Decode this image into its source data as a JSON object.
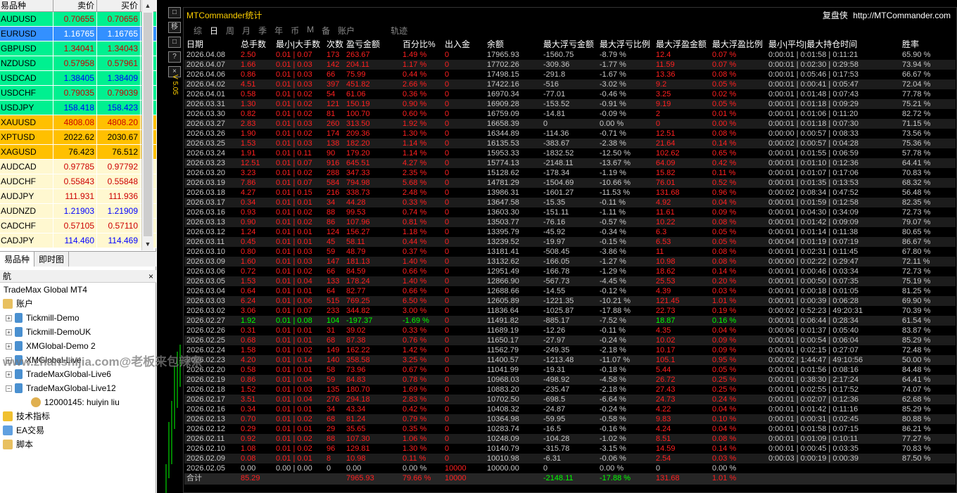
{
  "market_watch": {
    "col_symbol": "易品种",
    "col_bid": "卖价",
    "col_ask": "买价",
    "rows": [
      {
        "s": "AUDUSD",
        "b": "0.70655",
        "a": "0.70656",
        "bg": "#00f090",
        "fg": "#cc0000"
      },
      {
        "s": "EURUSD",
        "b": "1.16765",
        "a": "1.16765",
        "bg": "#3390ff",
        "fg": "#ffffff"
      },
      {
        "s": "GBPUSD",
        "b": "1.34041",
        "a": "1.34043",
        "bg": "#00f090",
        "fg": "#cc0000"
      },
      {
        "s": "NZDUSD",
        "b": "0.57958",
        "a": "0.57961",
        "bg": "#00f090",
        "fg": "#cc0000"
      },
      {
        "s": "USDCAD",
        "b": "1.38405",
        "a": "1.38409",
        "bg": "#00f090",
        "fg": "#0000ff"
      },
      {
        "s": "USDCHF",
        "b": "0.79035",
        "a": "0.79039",
        "bg": "#00f090",
        "fg": "#cc0000"
      },
      {
        "s": "USDJPY",
        "b": "158.418",
        "a": "158.423",
        "bg": "#00f090",
        "fg": "#0000ff"
      },
      {
        "s": "XAUUSD",
        "b": "4808.08",
        "a": "4808.20",
        "bg": "#ffc000",
        "fg": "#cc0000"
      },
      {
        "s": "XPTUSD",
        "b": "2022.62",
        "a": "2030.67",
        "bg": "#ffc000",
        "fg": "#000000"
      },
      {
        "s": "XAGUSD",
        "b": "76.423",
        "a": "76.512",
        "bg": "#ffc000",
        "fg": "#000000"
      },
      {
        "s": "AUDCAD",
        "b": "0.97785",
        "a": "0.97792",
        "bg": "#fff8d0",
        "fg": "#cc0000"
      },
      {
        "s": "AUDCHF",
        "b": "0.55843",
        "a": "0.55848",
        "bg": "#fff8d0",
        "fg": "#cc0000"
      },
      {
        "s": "AUDJPY",
        "b": "111.931",
        "a": "111.936",
        "bg": "#fff8d0",
        "fg": "#cc0000"
      },
      {
        "s": "AUDNZD",
        "b": "1.21903",
        "a": "1.21909",
        "bg": "#fff8d0",
        "fg": "#0000ff"
      },
      {
        "s": "CADCHF",
        "b": "0.57105",
        "a": "0.57110",
        "bg": "#fff8d0",
        "fg": "#cc0000"
      },
      {
        "s": "CADJPY",
        "b": "114.460",
        "a": "114.469",
        "bg": "#fff8d0",
        "fg": "#0000ff"
      }
    ],
    "tab_symbols": "易品种",
    "tab_tick": "即时图"
  },
  "navigator": {
    "title": "航",
    "close": "×",
    "root": "TradeMax Global MT4",
    "accounts": "账户",
    "items": [
      "Tickmill-Demo",
      "Tickmill-DemoUK",
      "XMGlobal-Demo 2",
      "XMGlobal-Live",
      "TradeMaxGlobal-Live6",
      "TradeMaxGlobal-Live12"
    ],
    "account": "12000145: huiyin liu",
    "indicators": "技术指标",
    "ea": "EA交易",
    "scripts": "脚本"
  },
  "watermark": "www.zhanshijia.com@老板来包辣条",
  "panel": {
    "title": "MTCommander统计",
    "brand": "复盘侠",
    "url": "http://MTCommander.com",
    "version": "V 5.05",
    "side_buttons": [
      "□",
      "移",
      "□",
      "?",
      "×"
    ],
    "tabs": [
      "综",
      "日",
      "周",
      "月",
      "季",
      "年",
      "币",
      "M",
      "备",
      "账户",
      "轨迹"
    ],
    "headers": [
      "日期",
      "总手数",
      "最小|大手数",
      "次数",
      "盈亏金额",
      "百分比%",
      "出入金",
      "余额",
      "最大浮亏金额",
      "最大浮亏比例",
      "最大浮盈金额",
      "最大浮盈比例",
      "最小|平均|最大持仓时间",
      "胜率"
    ],
    "rows": [
      [
        "2026.04.08",
        "2.50",
        "0.01 | 0.07",
        "173",
        "263.67",
        "1.49 %",
        "0",
        "17965.93",
        "-1560.75",
        "-8.79 %",
        "12.4",
        "0.07 %",
        "0:00:01 | 0:01:58 | 0:11:21",
        "65.90 %"
      ],
      [
        "2026.04.07",
        "1.66",
        "0.01 | 0.03",
        "142",
        "204.11",
        "1.17 %",
        "0",
        "17702.26",
        "-309.36",
        "-1.77 %",
        "11.59",
        "0.07 %",
        "0:00:01 | 0:02:30 | 0:29:58",
        "73.94 %"
      ],
      [
        "2026.04.06",
        "0.86",
        "0.01 | 0.03",
        "66",
        "75.99",
        "0.44 %",
        "0",
        "17498.15",
        "-291.8",
        "-1.67 %",
        "13.36",
        "0.08 %",
        "0:00:01 | 0:05:46 | 0:17:53",
        "66.67 %"
      ],
      [
        "2026.04.02",
        "4.51",
        "0.01 | 0.03",
        "397",
        "451.82",
        "2.66 %",
        "0",
        "17422.16",
        "-516",
        "-3.02 %",
        "9.2",
        "0.05 %",
        "0:00:01 | 0:00:41 | 0:05:47",
        "72.04 %"
      ],
      [
        "2026.04.01",
        "0.58",
        "0.01 | 0.02",
        "54",
        "61.06",
        "0.36 %",
        "0",
        "16970.34",
        "-77.01",
        "-0.46 %",
        "3.25",
        "0.02 %",
        "0:00:01 | 0:01:48 | 0:07:43",
        "77.78 %"
      ],
      [
        "2026.03.31",
        "1.30",
        "0.01 | 0.02",
        "121",
        "150.19",
        "0.90 %",
        "0",
        "16909.28",
        "-153.52",
        "-0.91 %",
        "9.19",
        "0.05 %",
        "0:00:01 | 0:01:18 | 0:09:29",
        "75.21 %"
      ],
      [
        "2026.03.30",
        "0.82",
        "0.01 | 0.02",
        "81",
        "100.70",
        "0.60 %",
        "0",
        "16759.09",
        "-14.81",
        "-0.09 %",
        "2",
        "0.01 %",
        "0:00:01 | 0:01:06 | 0:11:20",
        "82.72 %"
      ],
      [
        "2026.03.27",
        "2.83",
        "0.01 | 0.03",
        "260",
        "313.50",
        "1.92 %",
        "0",
        "16658.39",
        "0",
        "0.00 %",
        "0",
        "0.00 %",
        "0:00:01 | 0:01:18 | 0:07:30",
        "71.15 %"
      ],
      [
        "2026.03.26",
        "1.90",
        "0.01 | 0.02",
        "174",
        "209.36",
        "1.30 %",
        "0",
        "16344.89",
        "-114.36",
        "-0.71 %",
        "12.51",
        "0.08 %",
        "0:00:00 | 0:00:57 | 0:08:33",
        "73.56 %"
      ],
      [
        "2026.03.25",
        "1.53",
        "0.01 | 0.03",
        "138",
        "182.20",
        "1.14 %",
        "0",
        "16135.53",
        "-383.67",
        "-2.38 %",
        "21.64",
        "0.14 %",
        "0:00:02 | 0:00:57 | 0:04:28",
        "75.36 %"
      ],
      [
        "2026.03.24",
        "1.91",
        "0.01 | 0.11",
        "90",
        "179.20",
        "1.14 %",
        "0",
        "15953.33",
        "-1832.52",
        "-12.50 %",
        "102.62",
        "0.65 %",
        "0:00:01 | 0:01:55 | 0:06:59",
        "57.78 %"
      ],
      [
        "2026.03.23",
        "12.51",
        "0.01 | 0.07",
        "916",
        "645.51",
        "4.27 %",
        "0",
        "15774.13",
        "-2148.11",
        "-13.67 %",
        "64.09",
        "0.42 %",
        "0:00:01 | 0:01:10 | 0:12:36",
        "64.41 %"
      ],
      [
        "2026.03.20",
        "3.23",
        "0.01 | 0.02",
        "288",
        "347.33",
        "2.35 %",
        "0",
        "15128.62",
        "-178.34",
        "-1.19 %",
        "15.82",
        "0.11 %",
        "0:00:01 | 0:01:07 | 0:17:06",
        "70.83 %"
      ],
      [
        "2026.03.19",
        "7.86",
        "0.01 | 0.07",
        "584",
        "794.98",
        "5.68 %",
        "0",
        "14781.29",
        "-1504.69",
        "-10.66 %",
        "76.01",
        "0.52 %",
        "0:00:01 | 0:01:35 | 0:13:53",
        "68.32 %"
      ],
      [
        "2026.03.18",
        "4.27",
        "0.01 | 0.15",
        "216",
        "338.73",
        "2.48 %",
        "0",
        "13986.31",
        "-1601.27",
        "-11.53 %",
        "131.68",
        "0.96 %",
        "0:00:02 | 0:08:34 | 0:47:52",
        "56.48 %"
      ],
      [
        "2026.03.17",
        "0.34",
        "0.01 | 0.01",
        "34",
        "44.28",
        "0.33 %",
        "0",
        "13647.58",
        "-15.35",
        "-0.11 %",
        "4.92",
        "0.04 %",
        "0:00:01 | 0:01:59 | 0:12:58",
        "82.35 %"
      ],
      [
        "2026.03.16",
        "0.93",
        "0.01 | 0.02",
        "88",
        "99.53",
        "0.74 %",
        "0",
        "13603.30",
        "-151.11",
        "-1.11 %",
        "11.61",
        "0.09 %",
        "0:00:01 | 0:04:30 | 0:34:09",
        "72.73 %"
      ],
      [
        "2026.03.13",
        "0.90",
        "0.01 | 0.02",
        "86",
        "107.96",
        "0.81 %",
        "0",
        "13503.77",
        "-76.16",
        "-0.57 %",
        "10.22",
        "0.08 %",
        "0:00:01 | 0:01:42 | 0:09:09",
        "79.07 %"
      ],
      [
        "2026.03.12",
        "1.24",
        "0.01 | 0.01",
        "124",
        "156.27",
        "1.18 %",
        "0",
        "13395.79",
        "-45.92",
        "-0.34 %",
        "6.3",
        "0.05 %",
        "0:00:01 | 0:01:14 | 0:11:38",
        "80.65 %"
      ],
      [
        "2026.03.11",
        "0.45",
        "0.01 | 0.01",
        "45",
        "58.11",
        "0.44 %",
        "0",
        "13239.52",
        "-19.97",
        "-0.15 %",
        "6.53",
        "0.05 %",
        "0:00:04 | 0:01:19 | 0:07:19",
        "86.67 %"
      ],
      [
        "2026.03.10",
        "0.80",
        "0.01 | 0.03",
        "59",
        "48.79",
        "0.37 %",
        "0",
        "13181.41",
        "-508.45",
        "-3.86 %",
        "11",
        "0.08 %",
        "0:00:01 | 0:02:31 | 0:11:45",
        "67.80 %"
      ],
      [
        "2026.03.09",
        "1.60",
        "0.01 | 0.03",
        "147",
        "181.13",
        "1.40 %",
        "0",
        "13132.62",
        "-166.05",
        "-1.27 %",
        "10.98",
        "0.08 %",
        "0:00:00 | 0:02:22 | 0:29:47",
        "72.11 %"
      ],
      [
        "2026.03.06",
        "0.72",
        "0.01 | 0.02",
        "66",
        "84.59",
        "0.66 %",
        "0",
        "12951.49",
        "-166.78",
        "-1.29 %",
        "18.62",
        "0.14 %",
        "0:00:01 | 0:00:46 | 0:03:34",
        "72.73 %"
      ],
      [
        "2026.03.05",
        "1.53",
        "0.01 | 0.04",
        "133",
        "178.24",
        "1.40 %",
        "0",
        "12866.90",
        "-567.73",
        "-4.45 %",
        "25.53",
        "0.20 %",
        "0:00:01 | 0:00:50 | 0:07:35",
        "75.19 %"
      ],
      [
        "2026.03.04",
        "0.64",
        "0.01 | 0.01",
        "64",
        "82.77",
        "0.66 %",
        "0",
        "12688.66",
        "-14.55",
        "-0.12 %",
        "4.39",
        "0.03 %",
        "0:00:01 | 0:00:18 | 0:01:05",
        "81.25 %"
      ],
      [
        "2026.03.03",
        "6.24",
        "0.01 | 0.06",
        "515",
        "769.25",
        "6.50 %",
        "0",
        "12605.89",
        "-1221.35",
        "-10.21 %",
        "121.45",
        "1.01 %",
        "0:00:01 | 0:00:39 | 0:06:28",
        "69.90 %"
      ],
      [
        "2026.03.02",
        "3.06",
        "0.01 | 0.07",
        "233",
        "344.82",
        "3.00 %",
        "0",
        "11836.64",
        "-1025.87",
        "-17.88 %",
        "22.73",
        "0.19 %",
        "0:00:02 | 0:52:23 | 49:20:31",
        "70.39 %"
      ],
      [
        "2026.02.27",
        "1.92",
        "0.01 | 0.08",
        "104",
        "-197.37",
        "-1.69 %",
        "0",
        "11491.82",
        "-885.17",
        "-7.52 %",
        "18.87",
        "0.16 %",
        "0:00:01 | 0:06:44 | 0:28:34",
        "61.54 %"
      ],
      [
        "2026.02.26",
        "0.31",
        "0.01 | 0.01",
        "31",
        "39.02",
        "0.33 %",
        "0",
        "11689.19",
        "-12.26",
        "-0.11 %",
        "4.35",
        "0.04 %",
        "0:00:06 | 0:01:37 | 0:05:40",
        "83.87 %"
      ],
      [
        "2026.02.25",
        "0.68",
        "0.01 | 0.01",
        "68",
        "87.38",
        "0.76 %",
        "0",
        "11650.17",
        "-27.97",
        "-0.24 %",
        "10.02",
        "0.09 %",
        "0:00:01 | 0:00:54 | 0:06:04",
        "85.29 %"
      ],
      [
        "2026.02.24",
        "1.58",
        "0.01 | 0.02",
        "149",
        "162.22",
        "1.42 %",
        "0",
        "11562.79",
        "-249.35",
        "-2.18 %",
        "10.17",
        "0.09 %",
        "0:00:01 | 0:02:15 | 0:27:07",
        "72.48 %"
      ],
      [
        "2026.02.23",
        "4.20",
        "0.01 | 0.14",
        "140",
        "358.58",
        "3.25 %",
        "0",
        "11400.57",
        "-1213.48",
        "-11.07 %",
        "105.1",
        "0.95 %",
        "0:00:02 | 1:44:47 | 49:10:56",
        "50.00 %"
      ],
      [
        "2026.02.20",
        "0.58",
        "0.01 | 0.01",
        "58",
        "73.96",
        "0.67 %",
        "0",
        "11041.99",
        "-19.31",
        "-0.18 %",
        "5.44",
        "0.05 %",
        "0:00:01 | 0:01:56 | 0:08:16",
        "84.48 %"
      ],
      [
        "2026.02.19",
        "0.86",
        "0.01 | 0.04",
        "59",
        "84.83",
        "0.78 %",
        "0",
        "10968.03",
        "-498.92",
        "-4.58 %",
        "26.72",
        "0.25 %",
        "0:00:01 | 0:38:30 | 2:17:24",
        "64.41 %"
      ],
      [
        "2026.02.18",
        "1.52",
        "0.01 | 0.03",
        "135",
        "180.70",
        "1.69 %",
        "0",
        "10883.20",
        "-235.47",
        "-2.18 %",
        "27.43",
        "0.25 %",
        "0:00:01 | 0:02:55 | 0:17:52",
        "74.07 %"
      ],
      [
        "2026.02.17",
        "3.51",
        "0.01 | 0.04",
        "276",
        "294.18",
        "2.83 %",
        "0",
        "10702.50",
        "-698.5",
        "-6.64 %",
        "24.73",
        "0.24 %",
        "0:00:01 | 0:02:07 | 0:12:36",
        "62.68 %"
      ],
      [
        "2026.02.16",
        "0.34",
        "0.01 | 0.01",
        "34",
        "43.34",
        "0.42 %",
        "0",
        "10408.32",
        "-24.87",
        "-0.24 %",
        "4.22",
        "0.04 %",
        "0:00:01 | 0:01:42 | 0:11:16",
        "85.29 %"
      ],
      [
        "2026.02.13",
        "0.70",
        "0.01 | 0.02",
        "68",
        "81.24",
        "0.79 %",
        "0",
        "10364.98",
        "-59.95",
        "-0.58 %",
        "9.83",
        "0.10 %",
        "0:00:01 | 0:00:31 | 0:02:45",
        "80.88 %"
      ],
      [
        "2026.02.12",
        "0.29",
        "0.01 | 0.01",
        "29",
        "35.65",
        "0.35 %",
        "0",
        "10283.74",
        "-16.5",
        "-0.16 %",
        "4.24",
        "0.04 %",
        "0:00:01 | 0:01:58 | 0:07:15",
        "86.21 %"
      ],
      [
        "2026.02.11",
        "0.92",
        "0.01 | 0.02",
        "88",
        "107.30",
        "1.06 %",
        "0",
        "10248.09",
        "-104.28",
        "-1.02 %",
        "8.51",
        "0.08 %",
        "0:00:01 | 0:01:09 | 0:10:11",
        "77.27 %"
      ],
      [
        "2026.02.10",
        "1.08",
        "0.01 | 0.02",
        "96",
        "129.81",
        "1.30 %",
        "0",
        "10140.79",
        "-315.78",
        "-3.15 %",
        "14.59",
        "0.14 %",
        "0:00:01 | 0:00:45 | 0:03:35",
        "70.83 %"
      ],
      [
        "2026.02.09",
        "0.08",
        "0.01 | 0.01",
        "8",
        "10.98",
        "0.11 %",
        "0",
        "10010.98",
        "-6.31",
        "-0.06 %",
        "2.54",
        "0.03 %",
        "0:00:03 | 0:00:19 | 0:00:39",
        "87.50 %"
      ],
      [
        "2026.02.05",
        "0.00",
        "0.00 | 0.00",
        "0",
        "0.00",
        "0.00 %",
        "10000",
        "10000.00",
        "0",
        "0.00 %",
        "0",
        "0.00 %",
        "",
        "",
        ""
      ]
    ],
    "total": [
      "合计",
      "85.29",
      "",
      "",
      "7965.93",
      "79.66 %",
      "10000",
      "",
      "-2148.11",
      "-17.88 %",
      "131.68",
      "1.01 %",
      "",
      ""
    ]
  }
}
